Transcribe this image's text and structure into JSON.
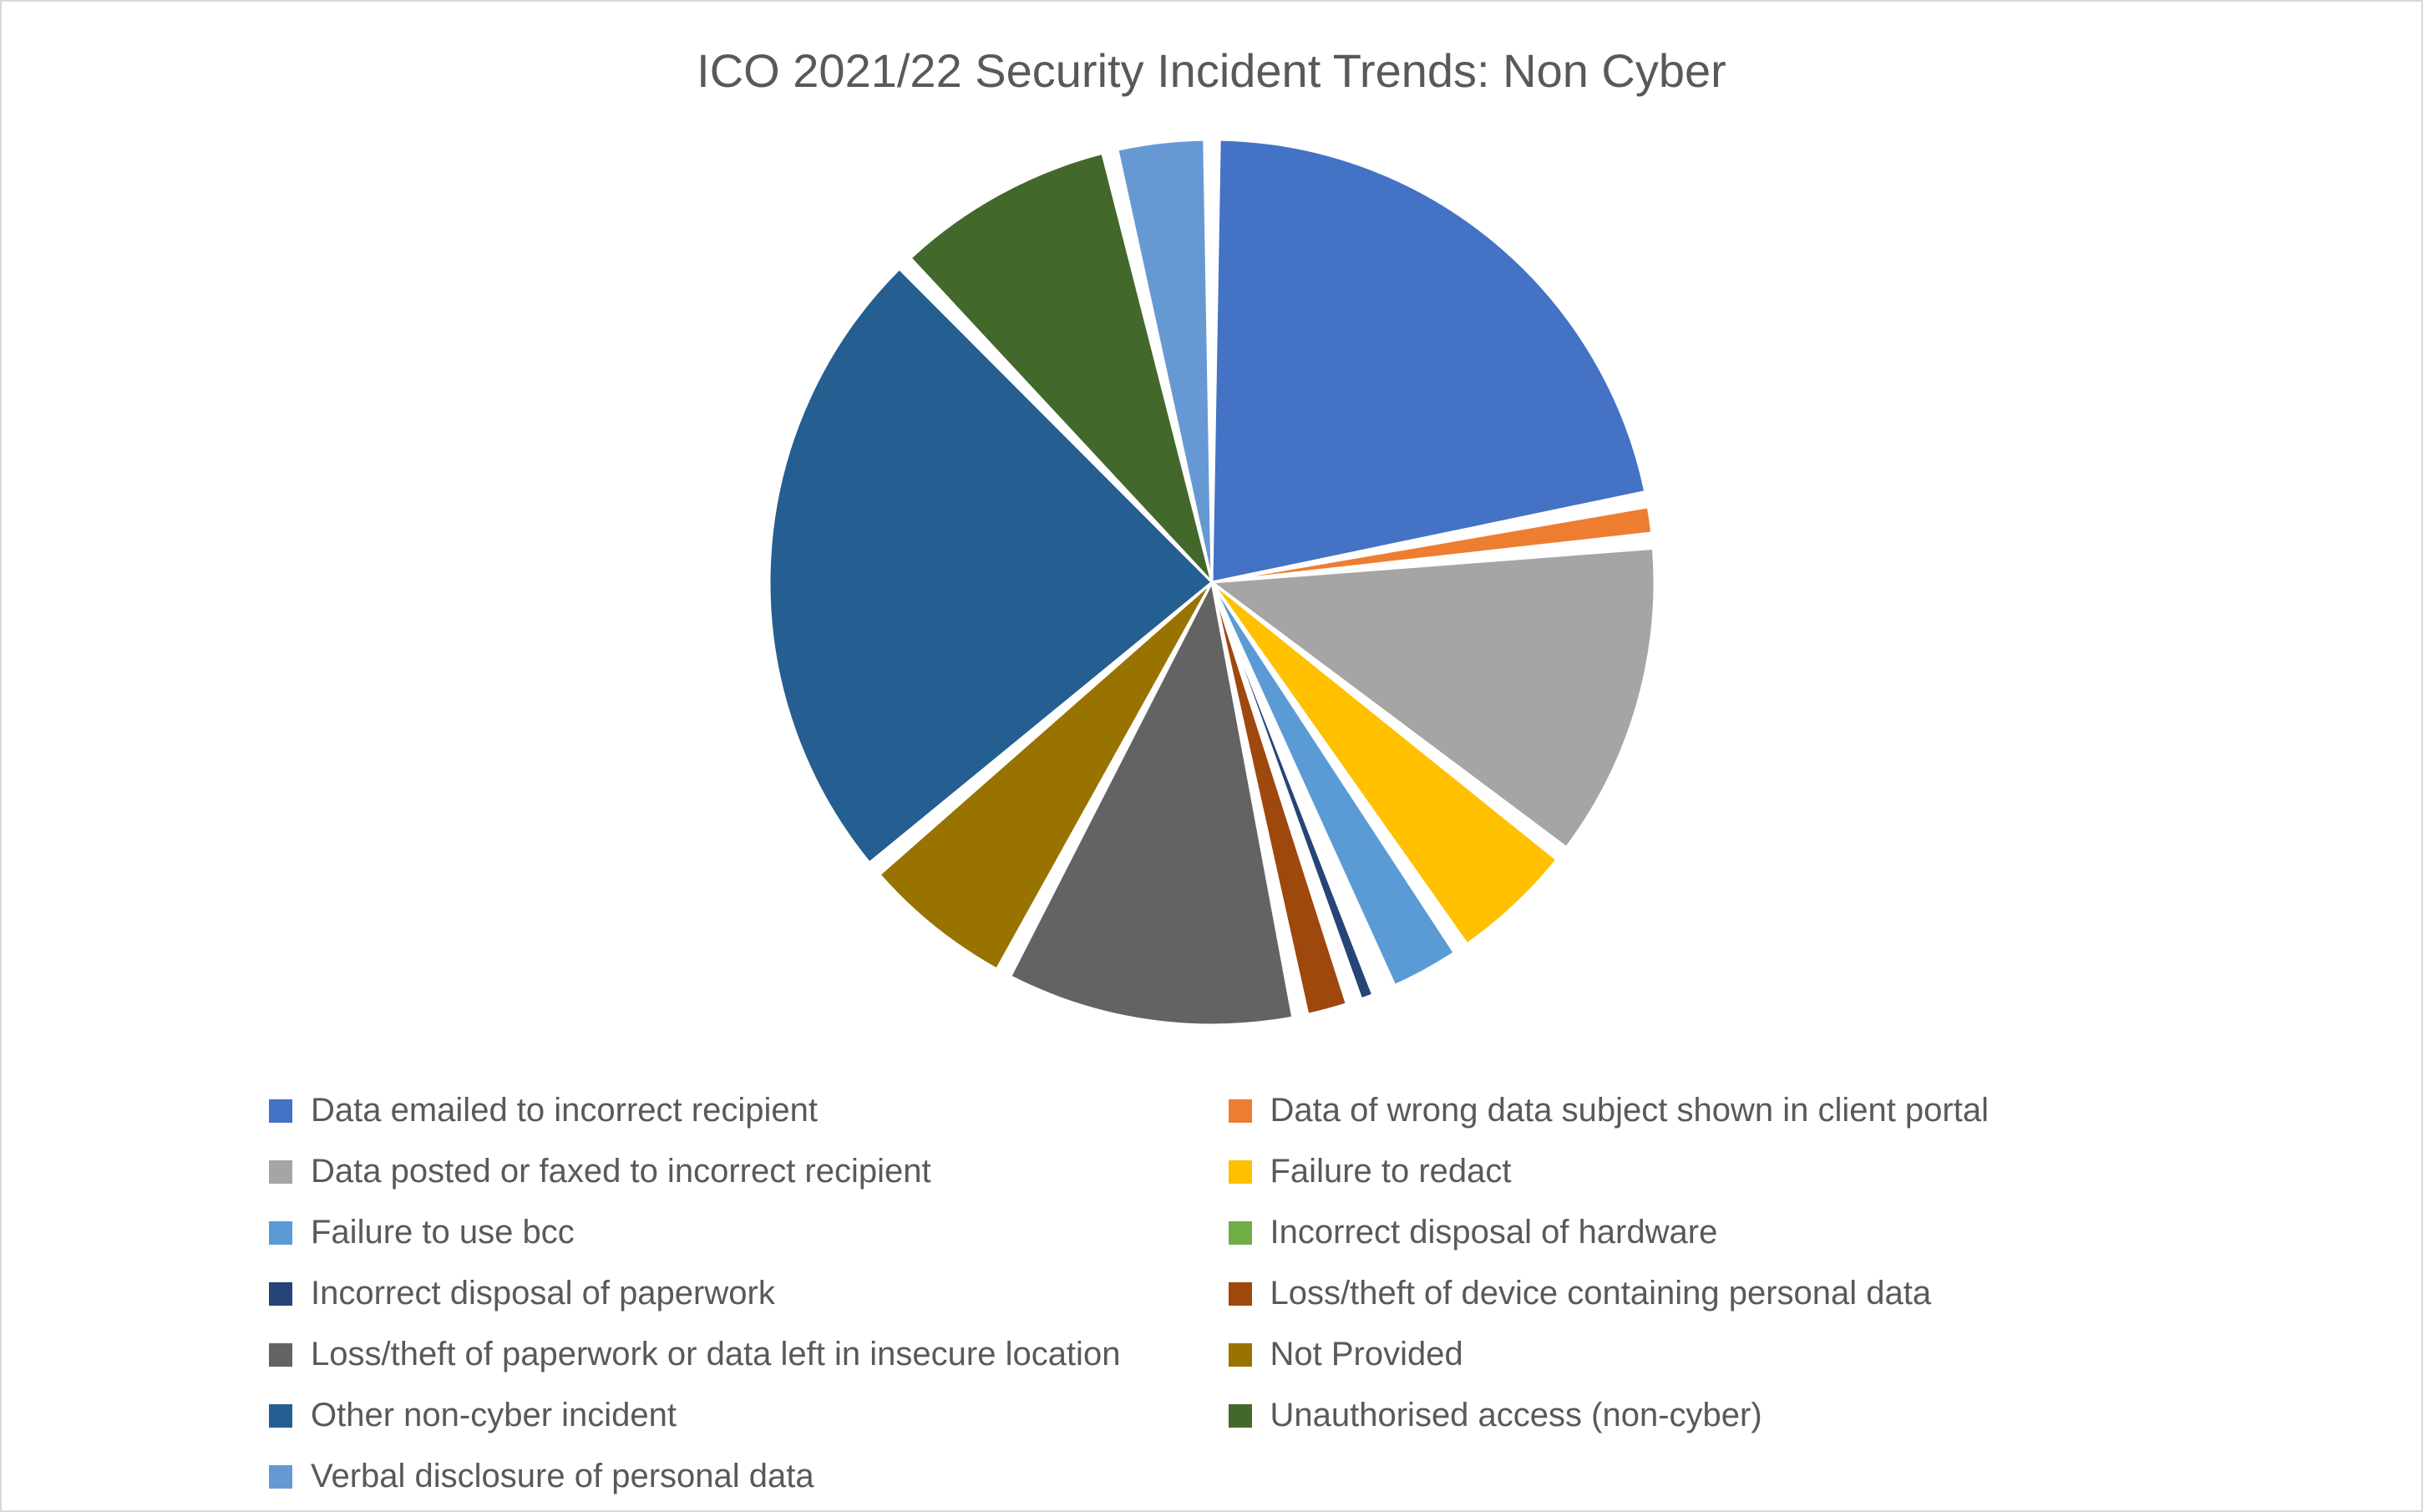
{
  "chart_data": {
    "type": "pie",
    "title": "ICO 2021/22 Security Incident Trends: Non Cyber",
    "series": [
      {
        "name": "Data emailed to incorrect recipient",
        "value": 22.0,
        "color": "#4472C4"
      },
      {
        "name": "Data of wrong data subject shown in client portal",
        "value": 1.5,
        "color": "#ED7D31"
      },
      {
        "name": "Data posted or faxed to incorrect recipient",
        "value": 12.0,
        "color": "#A5A5A5"
      },
      {
        "name": "Failure to redact",
        "value": 5.0,
        "color": "#FFC000"
      },
      {
        "name": "Failure to use bcc",
        "value": 3.0,
        "color": "#5B9BD5"
      },
      {
        "name": "Incorrect disposal of hardware",
        "value": 0.3,
        "color": "#70AD47"
      },
      {
        "name": "Incorrect disposal of paperwork",
        "value": 1.0,
        "color": "#264478"
      },
      {
        "name": "Loss/theft of device containing personal data",
        "value": 2.0,
        "color": "#9E480E"
      },
      {
        "name": "Loss/theft of paperwork or data left in insecure location",
        "value": 11.0,
        "color": "#636363"
      },
      {
        "name": "Not Provided",
        "value": 6.0,
        "color": "#997300"
      },
      {
        "name": "Other non-cyber incident",
        "value": 24.0,
        "color": "#255E91"
      },
      {
        "name": "Unauthorised access (non-cyber)",
        "value": 8.5,
        "color": "#43682B"
      },
      {
        "name": "Verbal disclosure of personal data",
        "value": 3.7,
        "color": "#6699D4"
      }
    ]
  }
}
